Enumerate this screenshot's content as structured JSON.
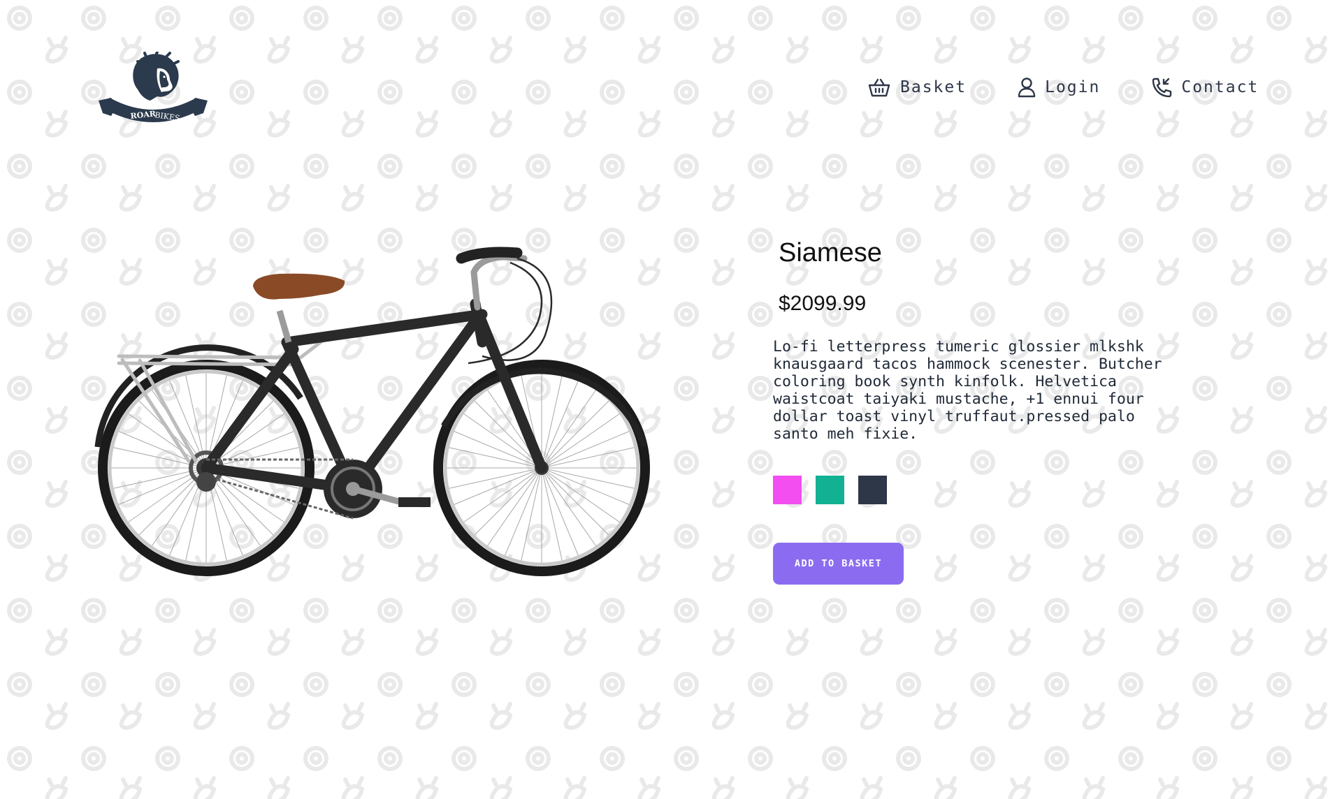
{
  "brand": {
    "logo_text_left": "ROAR",
    "logo_text_right": "BIKES"
  },
  "nav": {
    "basket": "Basket",
    "login": "Login",
    "contact": "Contact"
  },
  "icons": {
    "basket": "basket-icon",
    "login": "user-icon",
    "contact": "phone-incoming-icon",
    "logo": "lion-logo"
  },
  "product": {
    "name": "Siamese",
    "price": "$2099.99",
    "description": "Lo-fi letterpress tumeric glossier mlkshk knausgaard tacos hammock scenester. Butcher coloring book synth kinfolk. Helvetica waistcoat taiyaki mustache, +1 ennui four dollar toast vinyl truffaut.pressed palo santo meh fixie.",
    "colors": [
      "#f24ef0",
      "#13b193",
      "#2d3748"
    ],
    "add_button": "ADD TO BASKET"
  },
  "theme": {
    "accent": "#8b6cf0",
    "text": "#2d3748",
    "pattern": "#e8e8e8"
  }
}
